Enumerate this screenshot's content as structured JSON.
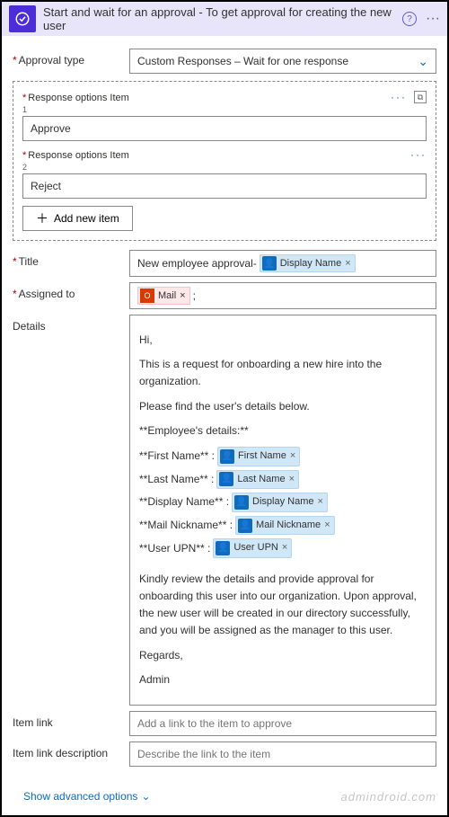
{
  "header": {
    "title": "Start and wait for an approval - To get approval for creating the new user"
  },
  "approvalType": {
    "label": "Approval type",
    "value": "Custom Responses – Wait for one response"
  },
  "responseOptions": {
    "label": "Response options Item",
    "items": [
      {
        "order": "1",
        "value": "Approve"
      },
      {
        "order": "2",
        "value": "Reject"
      }
    ],
    "addLabel": "Add new item"
  },
  "titleField": {
    "label": "Title",
    "prefix": "New employee approval-",
    "token": "Display Name"
  },
  "assignedTo": {
    "label": "Assigned to",
    "token": "Mail",
    "suffix": ";"
  },
  "details": {
    "label": "Details",
    "greeting": "Hi,",
    "intro": "This is a request for onboarding a new hire into the organization.",
    "subhead": "Please find the user's details below.",
    "sectionTitle": "**Employee's details:**",
    "fields": [
      {
        "label": "**First Name** :",
        "token": "First Name"
      },
      {
        "label": "**Last Name** :",
        "token": "Last Name"
      },
      {
        "label": "**Display Name** :",
        "token": "Display Name"
      },
      {
        "label": "**Mail Nickname** :",
        "token": "Mail Nickname"
      },
      {
        "label": "**User UPN** :",
        "token": "User UPN"
      }
    ],
    "closing": "Kindly review the details and provide approval for onboarding this user into our organization. Upon approval, the new user will be created in our directory successfully, and you will be assigned as the manager to this user.",
    "regards": "Regards,",
    "signature": "Admin"
  },
  "itemLink": {
    "label": "Item link",
    "placeholder": "Add a link to the item to approve"
  },
  "itemLinkDesc": {
    "label": "Item link description",
    "placeholder": "Describe the link to the item"
  },
  "showAdvanced": "Show advanced options",
  "watermark": "admindroid.com"
}
